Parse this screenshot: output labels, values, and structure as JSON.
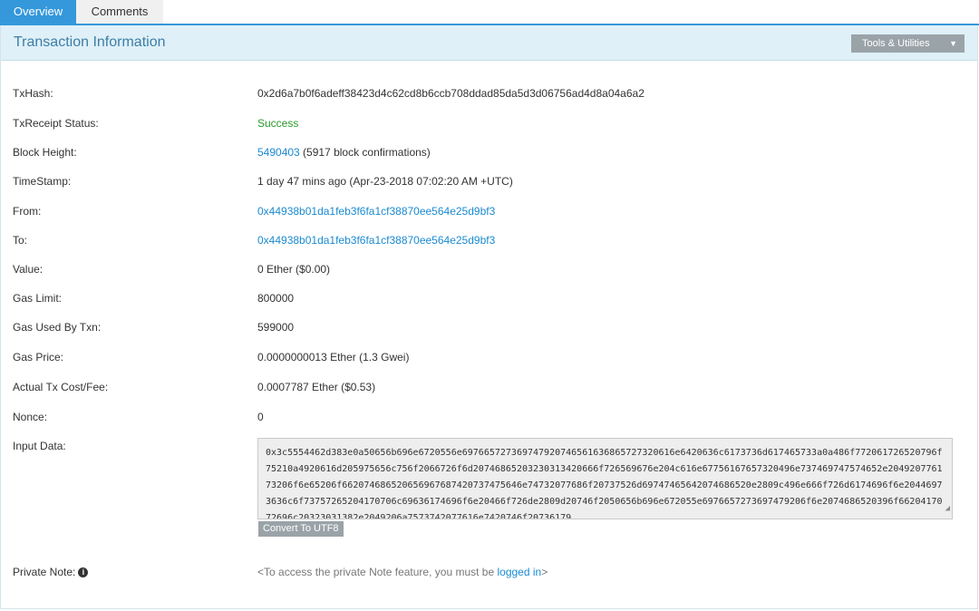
{
  "tabs": {
    "overview": "Overview",
    "comments": "Comments"
  },
  "header": {
    "title": "Transaction Information",
    "tools_label": "Tools & Utilities",
    "tools_caret": "▼"
  },
  "fields": {
    "txhash": {
      "label": "TxHash:",
      "value": "0x2d6a7b0f6adeff38423d4c62cd8b6ccb708ddad85da5d3d06756ad4d8a04a6a2"
    },
    "status": {
      "label": "TxReceipt Status:",
      "value": "Success"
    },
    "block": {
      "label": "Block Height:",
      "value": "5490403",
      "suffix": " (5917 block confirmations)"
    },
    "timestamp": {
      "label": "TimeStamp:",
      "value": "1 day 47 mins ago (Apr-23-2018 07:02:20 AM +UTC)"
    },
    "from": {
      "label": "From:",
      "value": "0x44938b01da1feb3f6fa1cf38870ee564e25d9bf3"
    },
    "to": {
      "label": "To:",
      "value": "0x44938b01da1feb3f6fa1cf38870ee564e25d9bf3"
    },
    "value": {
      "label": "Value:",
      "value": "0 Ether ($0.00)"
    },
    "gas_limit": {
      "label": "Gas Limit:",
      "value": "800000"
    },
    "gas_used": {
      "label": "Gas Used By Txn:",
      "value": "599000"
    },
    "gas_price": {
      "label": "Gas Price:",
      "value": "0.0000000013 Ether (1.3 Gwei)"
    },
    "fee": {
      "label": "Actual Tx Cost/Fee:",
      "value": "0.0007787 Ether ($0.53)"
    },
    "nonce": {
      "label": "Nonce:",
      "value": "0"
    },
    "input": {
      "label": "Input Data:",
      "value": "0x3c5554462d383e0a50656b696e6720556e697665727369747920746561636865727320616e6420636c6173736d617465733a0a486f772061726520796f75210a4920616d205975656c756f2066726f6d20746865203230313420666f726569676e204c616e67756167657320496e737469747574652e204920776173206f6e65206f662074686520656967687420737475646e74732077686f20737526d69747465642074686520e2809c496e666f726d6174696f6e20446973636c6f73757265204170706c69636174696f6e20466f726de2809d20746f2050656b696e672055e6976657273697479206f6e2074686520396f6620417072696c20323031382e2049206a7573742077616e7420746f20736179"
    },
    "convert_label": "Convert To UTF8",
    "private_note": {
      "label": "Private Note:",
      "info": "i",
      "prefix": "<To access the private Note feature, you must be ",
      "link": "logged in",
      "suffix": ">"
    }
  }
}
